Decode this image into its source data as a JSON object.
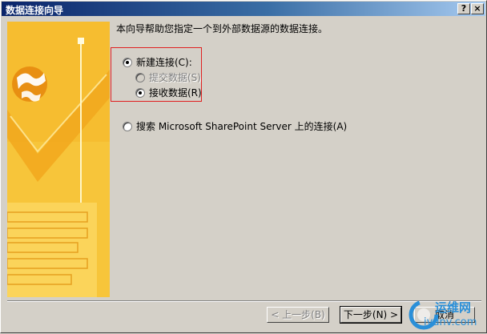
{
  "window": {
    "title": "数据连接向导",
    "help_glyph": "?",
    "close_glyph": "×"
  },
  "intro": "本向导帮助您指定一个到外部数据源的数据连接。",
  "options": {
    "new_connection": "新建连接(C):",
    "submit_data": "提交数据(S)",
    "receive_data": "接收数据(R)",
    "search_sharepoint": "搜索 Microsoft SharePoint Server 上的连接(A)"
  },
  "selected": {
    "main": "new_connection",
    "sub": "receive_data"
  },
  "buttons": {
    "back": "< 上一步(B)",
    "next": "下一步(N) >",
    "cancel": "取消"
  },
  "watermark": {
    "text": "运维网",
    "url": "iyunv.com"
  },
  "colors": {
    "title_start": "#0a246a",
    "title_end": "#a6caf0",
    "side_panel": "#f7c53a",
    "highlight": "#e02020"
  }
}
